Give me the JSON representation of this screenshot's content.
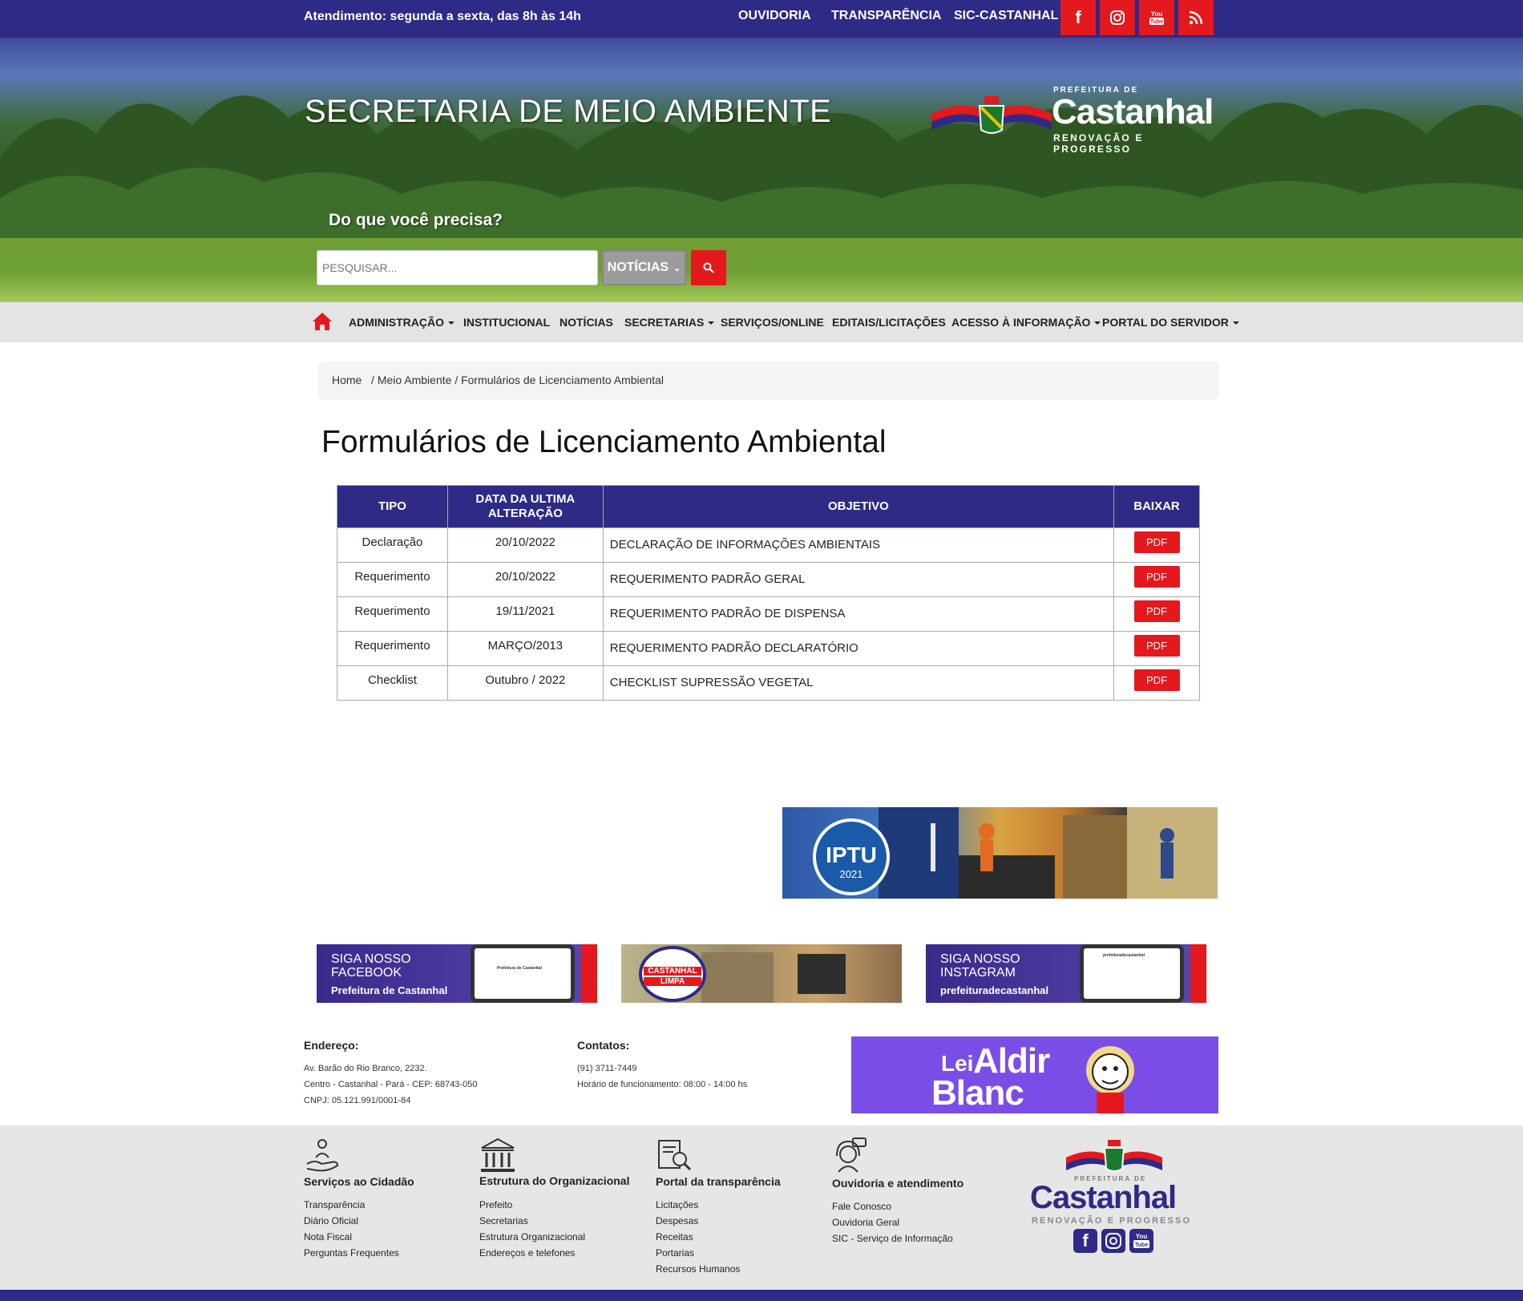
{
  "topbar": {
    "hours": "Atendimento: segunda a sexta, das 8h às 14h",
    "links": [
      "OUVIDORIA",
      "TRANSPARÊNCIA",
      "SIC-CASTANHAL"
    ],
    "social": [
      {
        "icon": "facebook-icon",
        "glyph": "f"
      },
      {
        "icon": "instagram-icon",
        "glyph": "◎"
      },
      {
        "icon": "youtube-icon",
        "glyph": "You Tube"
      },
      {
        "icon": "rss-icon",
        "glyph": "◝"
      }
    ]
  },
  "hero": {
    "title": "SECRETARIA DE MEIO AMBIENTE",
    "question": "Do que você precisa?",
    "search_placeholder": "PESQUISAR...",
    "search_category": "NOTÍCIAS"
  },
  "logo": {
    "prefix": "PREFEITURA DE",
    "name": "Castanhal",
    "tagline": "RENOVAÇÃO E PROGRESSO"
  },
  "nav": {
    "items": [
      {
        "label": "ADMINISTRAÇÃO",
        "dropdown": true
      },
      {
        "label": "INSTITUCIONAL",
        "dropdown": false
      },
      {
        "label": "NOTÍCIAS",
        "dropdown": false
      },
      {
        "label": "SECRETARIAS",
        "dropdown": true
      },
      {
        "label": "SERVIÇOS/ONLINE",
        "dropdown": false
      },
      {
        "label": "EDITAIS/LICITAÇÕES",
        "dropdown": false
      },
      {
        "label": "ACESSO À INFORMAÇÃO",
        "dropdown": true
      },
      {
        "label": "PORTAL DO SERVIDOR",
        "dropdown": true
      }
    ]
  },
  "breadcrumb": {
    "home": "Home",
    "section": "Meio Ambiente",
    "current": "Formulários de Licenciamento Ambiental"
  },
  "page": {
    "title": "Formulários de Licenciamento Ambiental"
  },
  "table": {
    "headers": [
      "TIPO",
      "DATA DA ULTIMA ALTERAÇÃO",
      "OBJETIVO",
      "BAIXAR"
    ],
    "rows": [
      {
        "tipo": "Declaração",
        "data": "20/10/2022",
        "objetivo": "DECLARAÇÃO DE INFORMAÇÕES AMBIENTAIS",
        "baixar": "PDF"
      },
      {
        "tipo": "Requerimento",
        "data": "20/10/2022",
        "objetivo": "REQUERIMENTO PADRÃO GERAL",
        "baixar": "PDF"
      },
      {
        "tipo": "Requerimento",
        "data": "19/11/2021",
        "objetivo": "REQUERIMENTO PADRÃO DE DISPENSA",
        "baixar": "PDF"
      },
      {
        "tipo": "Requerimento",
        "data": "MARÇO/2013",
        "objetivo": "REQUERIMENTO PADRÃO DECLARATÓRIO",
        "baixar": "PDF"
      },
      {
        "tipo": "Checklist",
        "data": "Outubro / 2022",
        "objetivo": "CHECKLIST SUPRESSÃO VEGETAL",
        "baixar": "PDF"
      }
    ]
  },
  "banners": {
    "iptu": {
      "title": "IPTU",
      "year": "2021"
    },
    "facebook": {
      "line1": "SIGA NOSSO",
      "line2": "FACEBOOK",
      "line3": "Prefeitura de Castanhal",
      "card": "Prefeitura de Castanhal"
    },
    "limpa": {
      "line1": "CASTANHAL",
      "line2": "LIMPA"
    },
    "instagram": {
      "line1": "SIGA NOSSO",
      "line2": "INSTAGRAM",
      "line3": "prefeituradecastanhal",
      "card": "prefeituradecastanhal"
    },
    "aldir": {
      "line1": "Lei",
      "line2": "Aldir",
      "line3": "Blanc"
    }
  },
  "address": {
    "label": "Endereço:",
    "line1": "Av. Barão do Rio Branco, 2232.",
    "line2": "Centro - Castanhal - Pará - CEP: 68743-050",
    "line3": "CNPJ: 05.121.991/0001-84"
  },
  "contacts": {
    "label": "Contatos:",
    "phone": "(91) 3711-7449",
    "hours": "Horário de funcionamento: 08:00 - 14:00 hs"
  },
  "footer": {
    "columns": [
      {
        "title": "Serviços ao Cidadão",
        "icon": "hand-person-icon",
        "links": [
          "Transparência",
          "Diário Oficial",
          "Nota Fiscal",
          "Perguntas Frequentes"
        ]
      },
      {
        "title": "Estrutura do Organizacional",
        "icon": "building-icon",
        "links": [
          "Prefeito",
          "Secretarias",
          "Estrutura Organizacional",
          "Endereços e telefones"
        ]
      },
      {
        "title": "Portal da transparência",
        "icon": "document-search-icon",
        "links": [
          "Licitações",
          "Despesas",
          "Receitas",
          "Portarias",
          "Recursos Humanos"
        ]
      },
      {
        "title": "Ouvidoria e atendimento",
        "icon": "headset-icon",
        "links": [
          "Fale Conosco",
          "Ouvidoria Geral",
          "SIC - Serviço de Informação"
        ]
      }
    ]
  }
}
